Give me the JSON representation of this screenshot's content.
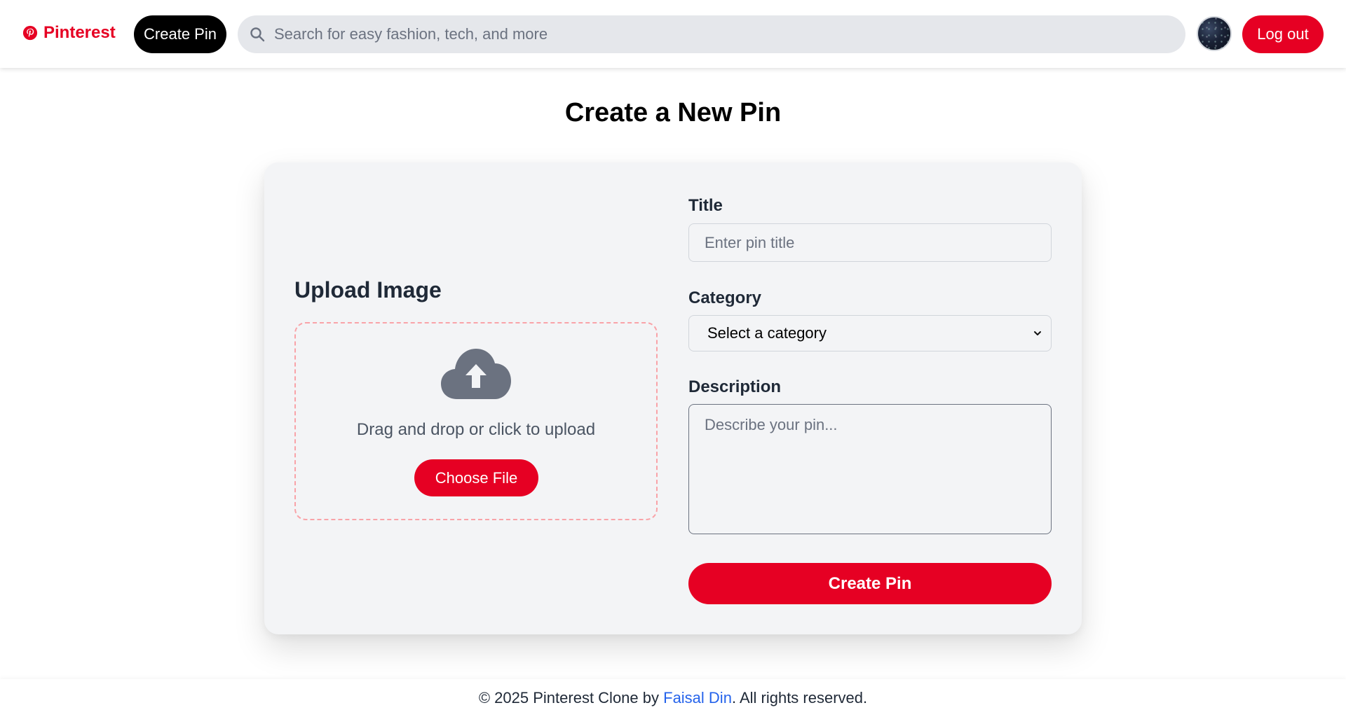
{
  "header": {
    "brand": "Pinterest",
    "create_pin_label": "Create Pin",
    "search_placeholder": "Search for easy fashion, tech, and more",
    "logout_label": "Log out"
  },
  "page": {
    "title": "Create a New Pin"
  },
  "upload": {
    "heading": "Upload Image",
    "drop_text": "Drag and drop or click to upload",
    "choose_file_label": "Choose File"
  },
  "form": {
    "title_label": "Title",
    "title_placeholder": "Enter pin title",
    "category_label": "Category",
    "category_selected": "Select a category",
    "description_label": "Description",
    "description_placeholder": "Describe your pin...",
    "submit_label": "Create Pin"
  },
  "footer": {
    "prefix": "© 2025 Pinterest Clone by ",
    "author": "Faisal Din",
    "suffix": ". All rights reserved."
  },
  "colors": {
    "brand_red": "#e60023",
    "link_blue": "#2563eb",
    "card_bg": "#f3f4f6"
  },
  "icons": [
    "pinterest-logo-icon",
    "search-icon",
    "cloud-upload-icon",
    "chevron-down-icon"
  ]
}
